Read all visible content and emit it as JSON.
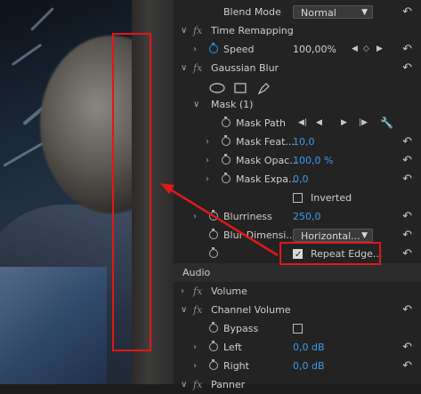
{
  "effects": {
    "blend_mode": {
      "label": "Blend Mode",
      "value": "Normal"
    },
    "time_remapping": {
      "label": "Time Remapping",
      "speed": {
        "label": "Speed",
        "value": "100,00%"
      }
    },
    "gaussian_blur": {
      "label": "Gaussian Blur",
      "mask": {
        "label": "Mask (1)",
        "path": "Mask Path",
        "feather": {
          "label": "Mask Feat...",
          "value": "10,0"
        },
        "opacity": {
          "label": "Mask Opac...",
          "value": "100,0 %"
        },
        "expansion": {
          "label": "Mask Expa...",
          "value": "0,0"
        },
        "inverted": {
          "label": "Inverted",
          "checked": false
        }
      },
      "blurriness": {
        "label": "Blurriness",
        "value": "250,0"
      },
      "blur_dimensions": {
        "label": "Blur Dimensi...",
        "value": "Horizontal..."
      },
      "repeat_edge": {
        "label": "Repeat Edge...",
        "checked": true
      }
    },
    "audio_section": "Audio",
    "volume": {
      "label": "Volume"
    },
    "channel_volume": {
      "label": "Channel Volume",
      "bypass": {
        "label": "Bypass",
        "checked": false
      },
      "left": {
        "label": "Left",
        "value": "0,0 dB"
      },
      "right": {
        "label": "Right",
        "value": "0,0 dB"
      }
    },
    "panner": {
      "label": "Panner"
    }
  },
  "colors": {
    "accent": "#3b9bf0",
    "highlight": "#e01818"
  }
}
